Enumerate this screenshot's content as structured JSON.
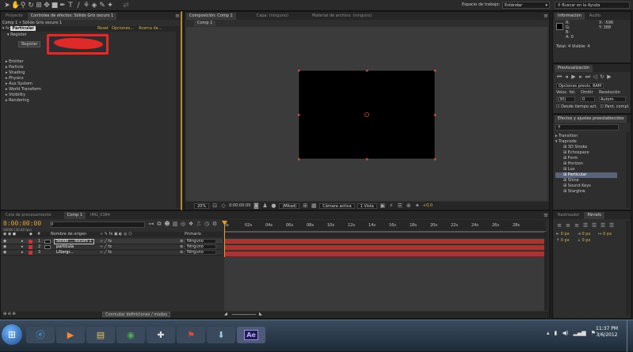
{
  "toolbar": {
    "workspace_label": "Espacio de trabajo:",
    "workspace_value": "Estándar",
    "help_search_placeholder": "Buscar en la Ayuda"
  },
  "effects_panel": {
    "tabs": [
      "Proyecto",
      "Controles de efectos: Sólido Gris oscuro 1"
    ],
    "breadcrumb": "Comp 1 • Sólido Gris oscuro 1",
    "effect_name": "Particular",
    "effect_links": [
      "Reset",
      "Opciones...",
      "Acerca de..."
    ],
    "register_group": "Register",
    "register_button": "Register",
    "groups": [
      "Emitter",
      "Particle",
      "Shading",
      "Physics",
      "Aux System",
      "World Transform",
      "Visibility",
      "Rendering"
    ]
  },
  "composition": {
    "tabs": [
      "Composición: Comp 1",
      "Capa: (ninguno)",
      "Material de archivo: (ninguno)"
    ],
    "sub_tab": "Comp 1",
    "zoom": "20%",
    "timecode": "0:00:00:00",
    "resolution": "(Mitad)",
    "camera": "Cámara activa",
    "views": "1 Vista",
    "exposure": "+0,0"
  },
  "info_panel": {
    "tabs": [
      "Información",
      "Audio"
    ],
    "r": "R:",
    "g": "G:",
    "b": "B:",
    "a": "A: 0",
    "x": "X: -596",
    "y": "Y: 388",
    "total": "Total: 4  Visible: 4"
  },
  "preview_panel": {
    "tab": "Previsualización",
    "ram_options": "Opciones previs. RAM",
    "frame_rate_label": "Veloc. fot.",
    "skip_label": "Omitir",
    "resolution_label": "Resolución",
    "frame_rate_value": "(30)",
    "skip_value": "0",
    "resolution_value": "Autom.",
    "from_current": "Desde tiempo act.",
    "full_screen": "Pant. compl."
  },
  "effects_presets": {
    "tab": "Efectos y ajustes preestablecidos",
    "categories": [
      "Transition",
      "Trapcode"
    ],
    "items": [
      "3D Stroke",
      "Echospace",
      "Form",
      "Horizon",
      "Lux",
      "Particular",
      "Shine",
      "Sound Keys",
      "Starglow"
    ],
    "selected": "Particular"
  },
  "timeline": {
    "tabs": [
      "Cola de procesamiento",
      "Comp 1",
      "IMG_0384"
    ],
    "timecode": "0:00:00:00",
    "frame_info": "00000 (30.00 fps)",
    "col_name": "Nombre de origen",
    "col_parent": "Primario",
    "layers": [
      {
        "num": "1",
        "name": "Sólido ... oscuro 1",
        "parent": "Ninguno",
        "color": "#c03a3a"
      },
      {
        "num": "2",
        "name": "partícula",
        "parent": "Ninguno",
        "color": "#c03a3a"
      },
      {
        "num": "3",
        "name": "LiSergi...",
        "parent": "Ninguno",
        "color": "#c03a3a"
      }
    ],
    "ruler": [
      "0s",
      "02s",
      "04s",
      "06s",
      "08s",
      "10s",
      "12s",
      "14s",
      "16s",
      "18s",
      "20s",
      "22s",
      "24s",
      "26s",
      "28s"
    ],
    "switch_modes": "Conmutar definiciones / modos"
  },
  "tracker_panel": {
    "tabs": [
      "Rastreador",
      "Párrafo"
    ],
    "px_values": [
      "0 px",
      "0 px",
      "0 px",
      "0 px",
      "0 px"
    ]
  },
  "taskbar": {
    "time": "11:37 PM",
    "date": "3/6/2012",
    "ae_label": "Ae",
    "pinned": [
      "windows-orb",
      "ie",
      "media-player",
      "explorer",
      "chrome",
      "gamepad",
      "flag",
      "downloads",
      "after-effects"
    ]
  },
  "colors": {
    "accent_yellow": "#d8b84a",
    "layer_bar": "#a83434",
    "playhead": "#e89a2a",
    "annotation": "#e02a2a"
  }
}
